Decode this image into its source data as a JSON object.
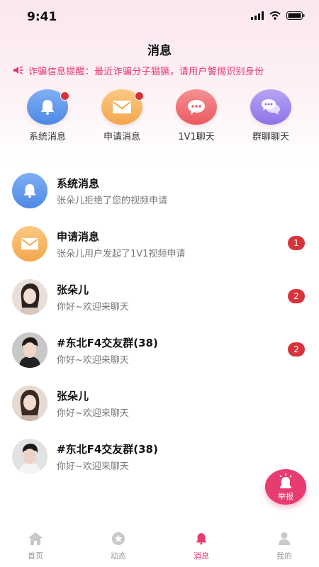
{
  "status": {
    "time": "9:41"
  },
  "header": {
    "title": "消息"
  },
  "notice": {
    "text": "诈骗信息提醒：最近诈骗分子猖獗，请用户警惕识别身份"
  },
  "quick": [
    {
      "label": "系统消息",
      "icon": "bell-icon",
      "color": "#5b95ec",
      "dot": true
    },
    {
      "label": "申请消息",
      "icon": "envelope-icon",
      "color": "#f7b461",
      "dot": true
    },
    {
      "label": "1V1聊天",
      "icon": "chat-bubble-icon",
      "color": "#f06f72",
      "dot": false
    },
    {
      "label": "群聊聊天",
      "icon": "group-chat-icon",
      "color": "#9d86ee",
      "dot": false
    }
  ],
  "messages": [
    {
      "name": "系统消息",
      "preview": "张朵儿拒绝了您的视频申请",
      "badge": "",
      "avatar": "bell-icon"
    },
    {
      "name": "申请消息",
      "preview": "张朵儿用户发起了1V1视频申请",
      "badge": "1",
      "avatar": "envelope-icon"
    },
    {
      "name": "张朵儿",
      "preview": "你好~欢迎来聊天",
      "badge": "2",
      "avatar": "user-photo"
    },
    {
      "name": "#东北F4交友群(38)",
      "preview": "你好~欢迎来聊天",
      "badge": "2",
      "avatar": "user-photo"
    },
    {
      "name": "张朵儿",
      "preview": "你好~欢迎来聊天",
      "badge": "",
      "avatar": "user-photo"
    },
    {
      "name": "#东北F4交友群(38)",
      "preview": "你好~欢迎来聊天",
      "badge": "",
      "avatar": "user-photo"
    }
  ],
  "report": {
    "label": "举报",
    "icon": "alarm-icon"
  },
  "tabs": [
    {
      "label": "首页",
      "icon": "home-icon",
      "active": false
    },
    {
      "label": "动态",
      "icon": "star-icon",
      "active": false
    },
    {
      "label": "消息",
      "icon": "bell-icon",
      "active": true
    },
    {
      "label": "我的",
      "icon": "person-icon",
      "active": false
    }
  ],
  "colors": {
    "accent": "#e63c6f",
    "badge": "#d6343a",
    "notice": "#e8356f"
  }
}
